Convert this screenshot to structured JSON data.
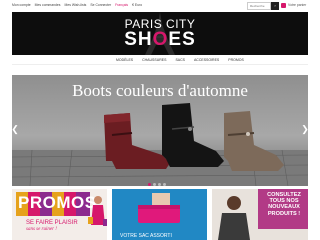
{
  "topbar": {
    "links": [
      "Mon compte",
      "Mes commandes",
      "Mes Wish-lists",
      "Se Connecter"
    ],
    "language": "Français",
    "currency": "€ Euro",
    "search_placeholder": "Recherche",
    "cart_label": "Votre panier"
  },
  "logo": {
    "line1": "PARIS CITY",
    "line2_a": "SH",
    "line2_o": "O",
    "line2_b": "ES"
  },
  "nav": {
    "items": [
      "MODÈLES",
      "CHAUSSURES",
      "SACS",
      "ACCESSOIRES",
      "PROMOS"
    ]
  },
  "hero": {
    "title": "Boots couleurs d'automne",
    "slides": 4,
    "active_slide": 1
  },
  "tiles": {
    "promo_word": "PROMOS",
    "promo_sub1": "SE FAIRE PLAISIR",
    "promo_sub2": "sans se ruiner !",
    "bag_text": "VOTRE SAC ASSORTI",
    "new_text": [
      "CONSULTEZ",
      "TOUS NOS",
      "NOUVEAUX",
      "PRODUITS !"
    ]
  },
  "colors": {
    "accent": "#d6176b",
    "header_bg": "#0d0d0d"
  }
}
